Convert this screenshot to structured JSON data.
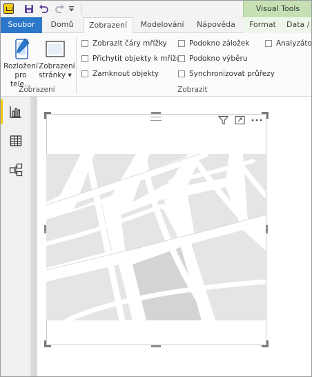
{
  "context_tab": {
    "label": "Visual Tools"
  },
  "tabs": [
    {
      "id": "file",
      "label": "Soubor"
    },
    {
      "id": "home",
      "label": "Domů"
    },
    {
      "id": "view",
      "label": "Zobrazení"
    },
    {
      "id": "modeling",
      "label": "Modelování"
    },
    {
      "id": "help",
      "label": "Nápověda"
    },
    {
      "id": "format",
      "label": "Format"
    },
    {
      "id": "data",
      "label": "Data / P"
    }
  ],
  "ribbon": {
    "layout_button": {
      "line1": "Rozložení",
      "line2": "pro tele..."
    },
    "page_view_button": {
      "line1": "Zobrazení",
      "line2": "stránky ▾"
    },
    "group_view_label": "Zobrazení",
    "group_show_label": "Zobrazit",
    "checkboxes": [
      {
        "label": "Zobrazit čáry mřížky",
        "checked": false
      },
      {
        "label": "Přichytit objekty k mřížce",
        "checked": false
      },
      {
        "label": "Zamknout objekty",
        "checked": false
      },
      {
        "label": "Podokno záložek",
        "checked": false
      },
      {
        "label": "Podokno výběru",
        "checked": false
      },
      {
        "label": "Synchronizovat průřezy",
        "checked": false
      },
      {
        "label": "Analyzátor",
        "checked": false
      }
    ]
  },
  "left_rail": [
    {
      "icon": "report-view-icon",
      "active": true
    },
    {
      "icon": "data-view-icon",
      "active": false
    },
    {
      "icon": "relationships-view-icon",
      "active": false
    }
  ],
  "visual": {
    "header_icons": [
      "filter-icon",
      "focus-mode-icon",
      "more-options-icon"
    ],
    "type": "map-placeholder"
  },
  "colors": {
    "file_tab": "#2b77c9",
    "context_tab": "#c6e0b4",
    "active_rail_marker": "#f2c811",
    "map_roads": "#e3e3e3"
  }
}
